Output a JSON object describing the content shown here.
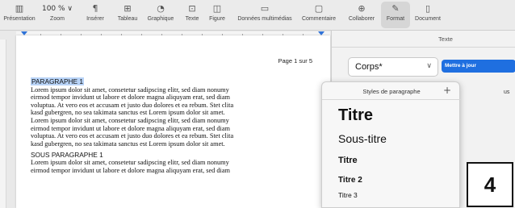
{
  "toolbar": {
    "items": [
      {
        "label": "Présentation",
        "icon": "sidebar-icon"
      },
      {
        "label": "Zoom",
        "value": "100 % ∨",
        "icon": "zoom-icon"
      },
      {
        "label": "Insérer",
        "icon": "pilcrow-icon"
      },
      {
        "label": "Tableau",
        "icon": "table-icon"
      },
      {
        "label": "Graphique",
        "icon": "chart-icon"
      },
      {
        "label": "Texte",
        "icon": "textbox-icon"
      },
      {
        "label": "Figure",
        "icon": "shape-icon"
      },
      {
        "label": "Données multimédias",
        "icon": "media-icon"
      },
      {
        "label": "Commentaire",
        "icon": "comment-icon"
      },
      {
        "label": "Collaborer",
        "icon": "collaborate-icon"
      },
      {
        "label": "Format",
        "icon": "brush-icon",
        "active": true
      },
      {
        "label": "Document",
        "icon": "document-icon"
      }
    ]
  },
  "document": {
    "page_label": "Page 1 sur 5",
    "heading1": "PARAGRAPHE 1",
    "para1": [
      "Lorem ipsum dolor sit amet, consetetur sadipscing elitr, sed diam nonumy",
      "eirmod tempor invidunt ut labore et dolore magna aliquyam erat, sed diam",
      "voluptua. At vero eos et accusam et justo duo dolores et ea rebum. Stet clita",
      "kasd gubergren, no sea takimata sanctus est Lorem ipsum dolor sit amet.",
      "Lorem ipsum dolor sit amet, consetetur sadipscing elitr, sed diam nonumy",
      "eirmod tempor invidunt ut labore et dolore magna aliquyam erat, sed diam",
      "voluptua. At vero eos et accusam et justo duo dolores et ea rebum. Stet clita",
      "kasd gubergren, no sea takimata sanctus est Lorem ipsum dolor sit amet."
    ],
    "heading2": "SOUS PARAGRAPHE 1",
    "para2": [
      "Lorem ipsum dolor sit amet, consetetur sadipscing elitr, sed diam nonumy",
      "eirmod tempor invidunt ut labore et dolore magna aliquyam erat, sed diam"
    ]
  },
  "panel": {
    "tab": "Texte",
    "style_value": "Corps*",
    "update_button": "Mettre à jour",
    "side_fragment": "us"
  },
  "popover": {
    "title": "Styles de paragraphe",
    "add": "+",
    "styles": [
      "Titre",
      "Sous-titre",
      "Titre",
      "Titre 2",
      "Titre 3"
    ]
  },
  "badge": "4"
}
